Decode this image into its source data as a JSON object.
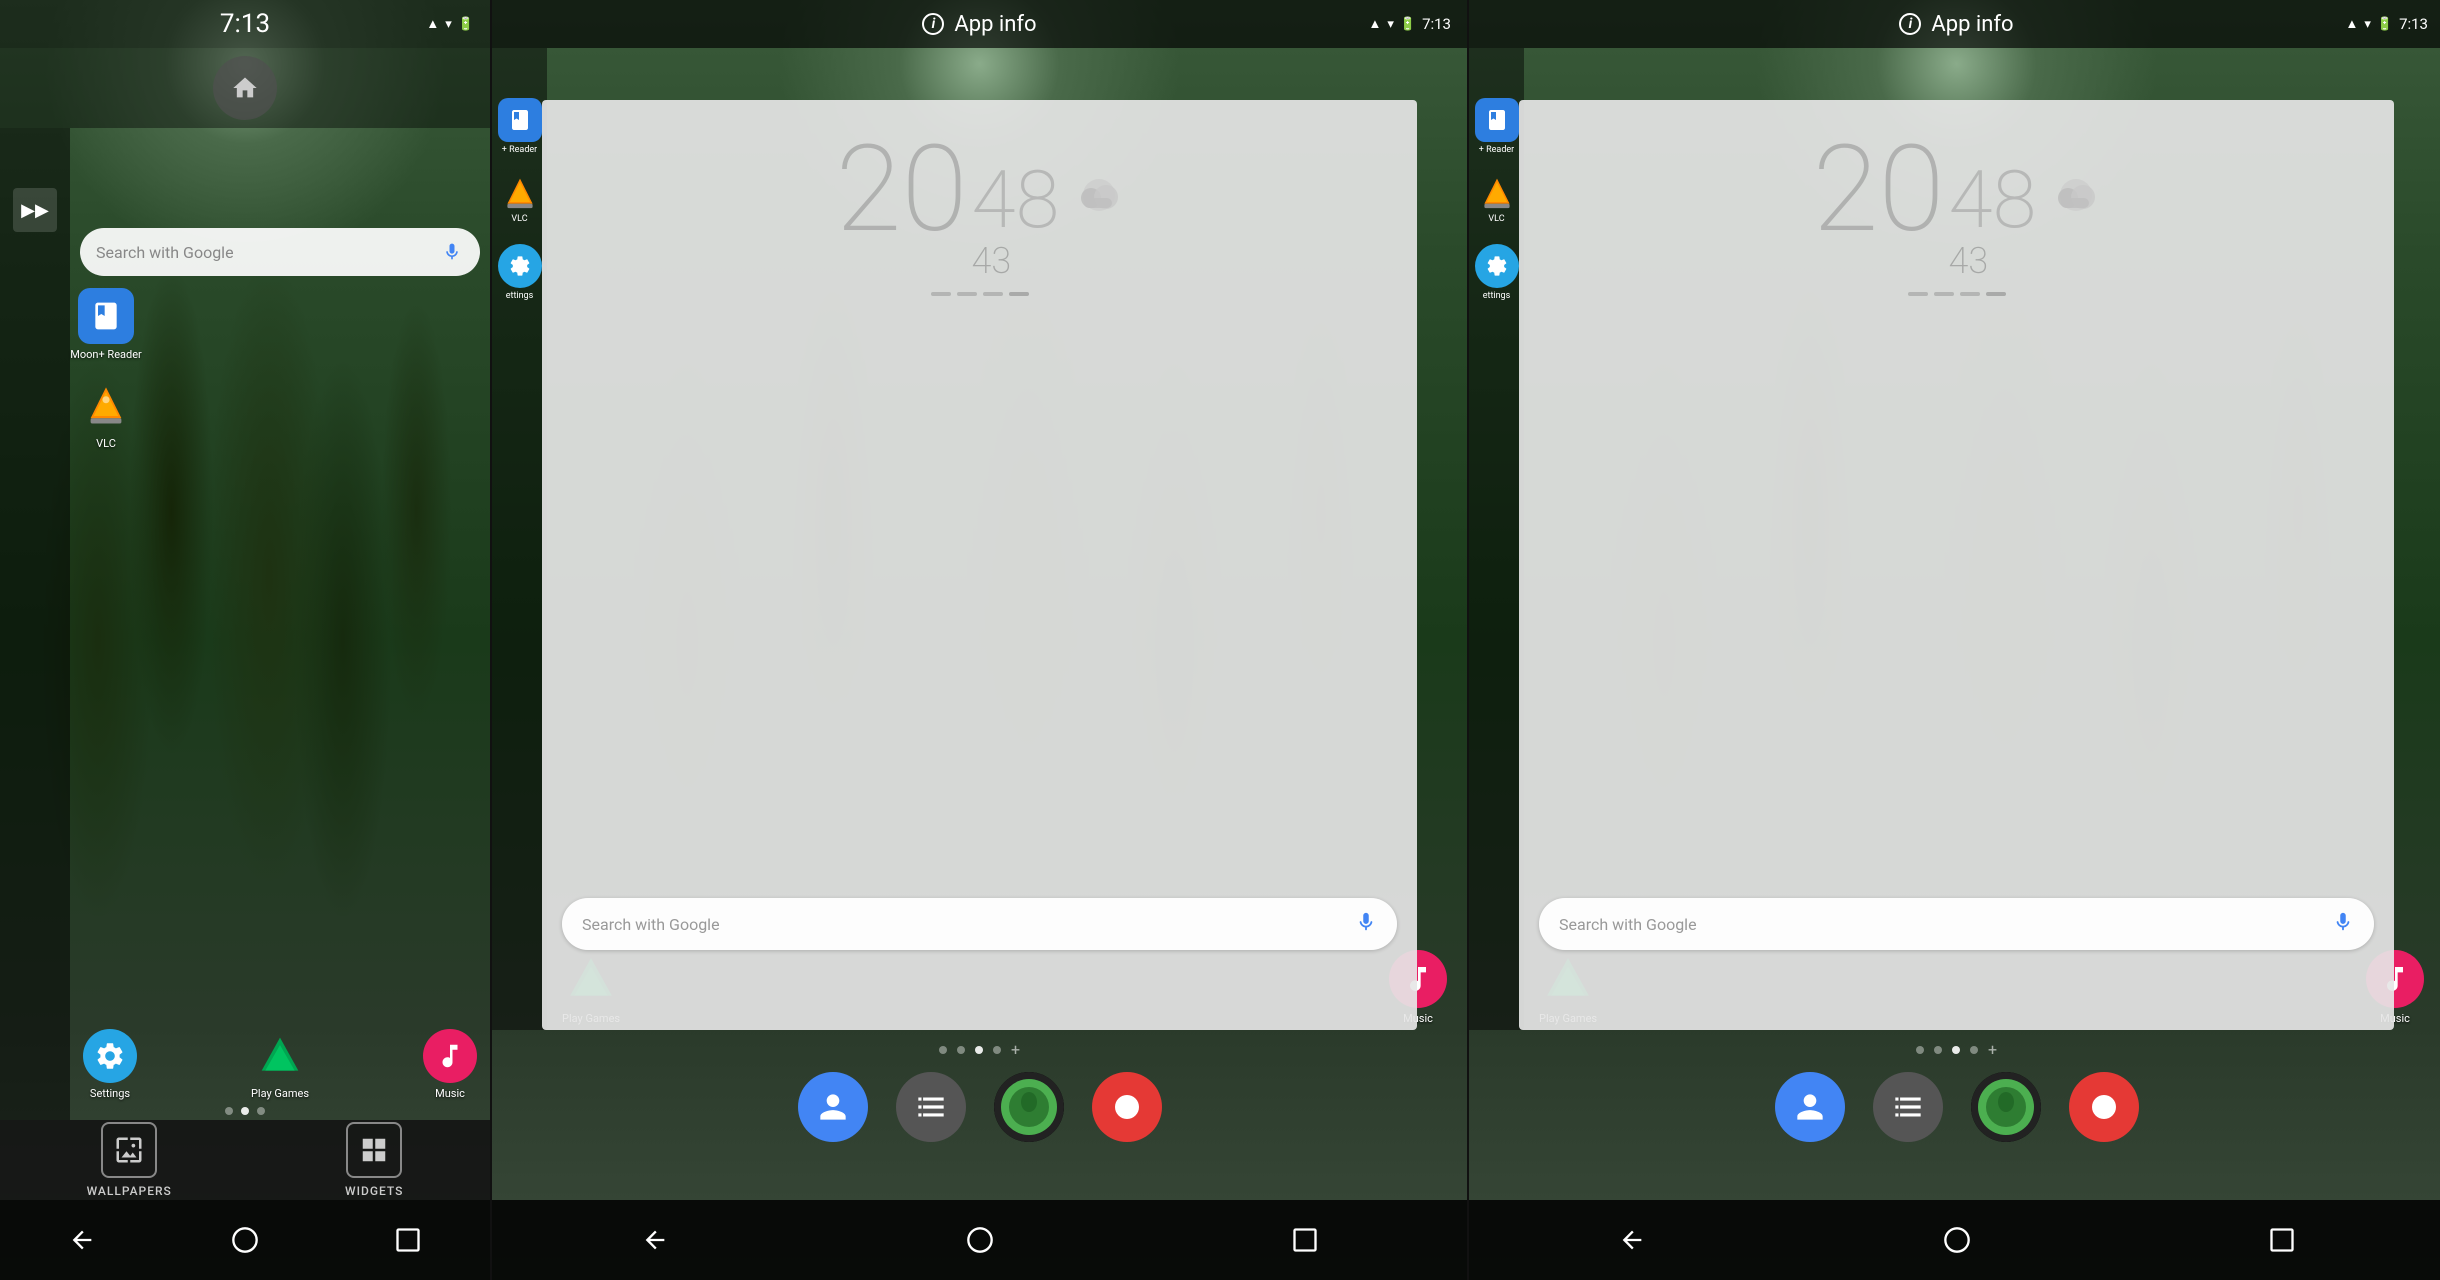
{
  "panel1": {
    "status": {
      "time": "7:13",
      "icons": [
        "signal",
        "wifi",
        "battery"
      ]
    },
    "search": {
      "placeholder": "Search with Google"
    },
    "apps": [
      {
        "id": "moon-reader",
        "label": "Moon+ Reader",
        "color": "#3a7bd5",
        "icon": "📖"
      },
      {
        "id": "vlc",
        "label": "VLC",
        "color": "#f80",
        "icon": "🔶"
      },
      {
        "id": "settings",
        "label": "Settings",
        "color": "#26a5e4",
        "icon": "⚙️"
      },
      {
        "id": "play-games",
        "label": "Play Games",
        "color": "#00a651",
        "icon": "▶"
      },
      {
        "id": "music",
        "label": "Music",
        "color": "#e91e63",
        "icon": "🎵"
      }
    ],
    "bottom": {
      "wallpapers_label": "WALLPAPERS",
      "widgets_label": "WIDGETS"
    },
    "nav": {
      "back": "◁",
      "home": "○",
      "recent": "□"
    }
  },
  "panel2": {
    "status": {
      "time": "7:13"
    },
    "appinfo_label": "App info",
    "clock": {
      "hour": "20",
      "minute": "48",
      "seconds": "43"
    },
    "search": {
      "placeholder": "Search with Google"
    },
    "dock": {
      "dots": [
        "●",
        "●",
        "●",
        "●",
        "+"
      ],
      "apps": [
        {
          "id": "contacts",
          "label": "",
          "color": "#4285f4",
          "icon": "👤"
        },
        {
          "id": "launcher",
          "label": "",
          "color": "#888",
          "icon": "⊞"
        },
        {
          "id": "av-face",
          "label": "",
          "color": "#4caf50",
          "icon": "●"
        },
        {
          "id": "scrcpy",
          "label": "",
          "color": "#e53935",
          "icon": "⏺"
        }
      ]
    }
  },
  "panel3": {
    "status": {
      "time": "7:13"
    },
    "appinfo_label": "App info",
    "clock": {
      "hour": "20",
      "minute": "48",
      "seconds": "43"
    },
    "search": {
      "placeholder": "Search with Google"
    },
    "dock": {
      "dots": [
        "●",
        "●",
        "●",
        "●",
        "+"
      ],
      "apps": [
        {
          "id": "contacts",
          "label": "",
          "color": "#4285f4",
          "icon": "👤"
        },
        {
          "id": "launcher",
          "label": "",
          "color": "#888",
          "icon": "⊞"
        },
        {
          "id": "av-face",
          "label": "",
          "color": "#4caf50",
          "icon": "●"
        },
        {
          "id": "scrcpy",
          "label": "",
          "color": "#e53935",
          "icon": "⏺"
        }
      ]
    }
  }
}
